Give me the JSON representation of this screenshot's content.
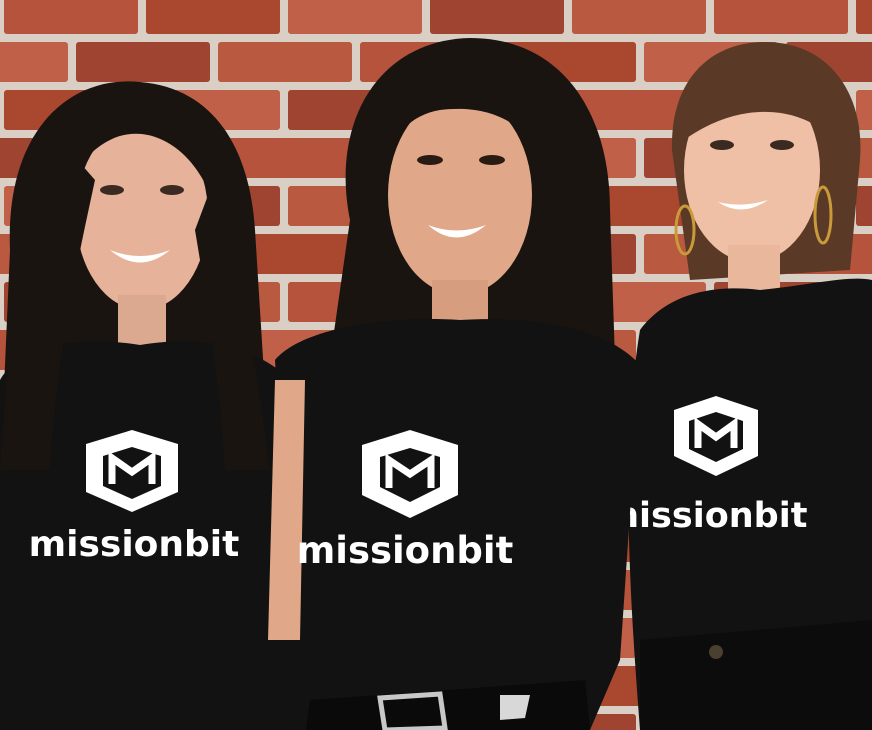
{
  "photo": {
    "people": [
      {
        "shirt_text": "missionbit",
        "logo_icon": "missionbit-hexagon-logo"
      },
      {
        "shirt_text": "missionbit",
        "logo_icon": "missionbit-hexagon-logo"
      },
      {
        "shirt_text": "missionbit",
        "logo_icon": "missionbit-hexagon-logo"
      }
    ],
    "colors": {
      "brick": "#b5533c",
      "mortar": "#e8dfd6",
      "shirt": "#121212",
      "print": "#ffffff",
      "hair": "#1a1411",
      "skin": "#e8b79c"
    }
  }
}
